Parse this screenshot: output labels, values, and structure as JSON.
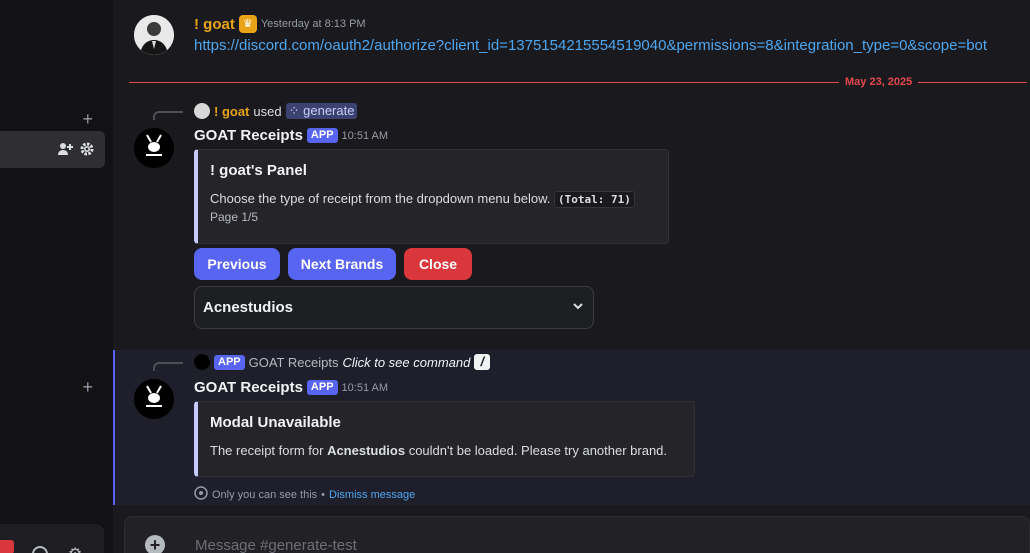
{
  "messages": {
    "first": {
      "username": "! goat",
      "timestamp": "Yesterday at 8:13 PM",
      "link": "https://discord.com/oauth2/authorize?client_id=1375154215554519040&permissions=8&integration_type=0&scope=bot"
    },
    "date_divider": "May 23, 2025",
    "second": {
      "reply_user": "! goat",
      "reply_used": "used",
      "reply_command": "generate",
      "username": "GOAT Receipts",
      "app_badge": "APP",
      "timestamp": "10:51 AM",
      "embed_title": "! goat's Panel",
      "embed_desc": "Choose the type of receipt from the dropdown menu below.",
      "embed_code": "(Total: 71)",
      "embed_footer": "Page 1/5",
      "buttons": {
        "previous": "Previous",
        "next": "Next Brands",
        "close": "Close"
      },
      "select_value": "Acnestudios"
    },
    "third": {
      "reply_app_badge": "APP",
      "reply_user": "GOAT Receipts",
      "reply_hint": "Click to see command",
      "username": "GOAT Receipts",
      "app_badge": "APP",
      "timestamp": "10:51 AM",
      "embed_title": "Modal Unavailable",
      "embed_desc_pre": "The receipt form for",
      "embed_desc_bold": "Acnestudios",
      "embed_desc_post": "couldn't be loaded. Please try another brand.",
      "ephemeral_note": "Only you can see this",
      "ephemeral_sep": "•",
      "dismiss": "Dismiss message"
    }
  },
  "composer": {
    "placeholder": "Message #generate-test"
  },
  "colors": {
    "accent": "#5865f2",
    "danger": "#da373c",
    "link": "#4ea6f0",
    "goat_name": "#e8a317"
  },
  "icons": [
    "plus-icon",
    "add-member-icon",
    "gear-icon",
    "crown-icon",
    "chevron-down-icon",
    "eye-icon",
    "slash-command-icon",
    "add-attachment-icon"
  ]
}
